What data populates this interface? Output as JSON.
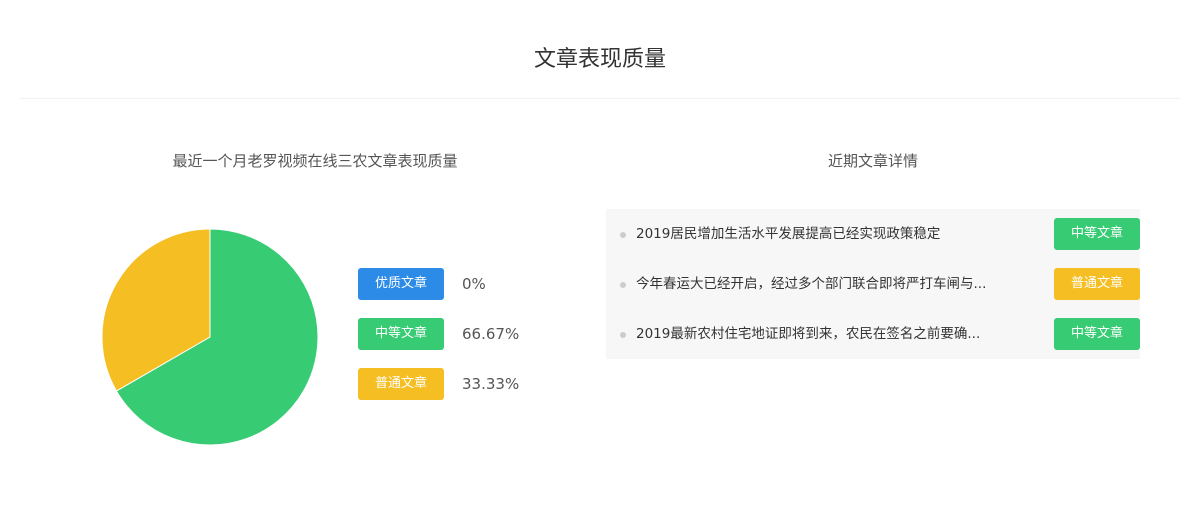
{
  "page": {
    "title": "文章表现质量"
  },
  "left": {
    "title": "最近一个月老罗视频在线三农文章表现质量"
  },
  "right": {
    "title": "近期文章详情",
    "articles": [
      {
        "title": "2019居民增加生活水平发展提高已经实现政策稳定",
        "tag": "中等文章",
        "tag_color": "#37cb74"
      },
      {
        "title": "今年春运大已经开启，经过多个部门联合即将严打车闸与...",
        "tag": "普通文章",
        "tag_color": "#f5be23"
      },
      {
        "title": "2019最新农村住宅地证即将到来，农民在签名之前要确...",
        "tag": "中等文章",
        "tag_color": "#37cb74"
      }
    ]
  },
  "legend": [
    {
      "label": "优质文章",
      "value": "0%",
      "color": "#2b8be6"
    },
    {
      "label": "中等文章",
      "value": "66.67%",
      "color": "#37cb74"
    },
    {
      "label": "普通文章",
      "value": "33.33%",
      "color": "#f5be23"
    }
  ],
  "chart_data": {
    "type": "pie",
    "title": "",
    "categories": [
      "优质文章",
      "中等文章",
      "普通文章"
    ],
    "values": [
      0,
      66.67,
      33.33
    ],
    "colors": [
      "#2b8be6",
      "#37cb74",
      "#f5be23"
    ],
    "start_angle": "top, clockwise",
    "legend_placement": "right"
  }
}
